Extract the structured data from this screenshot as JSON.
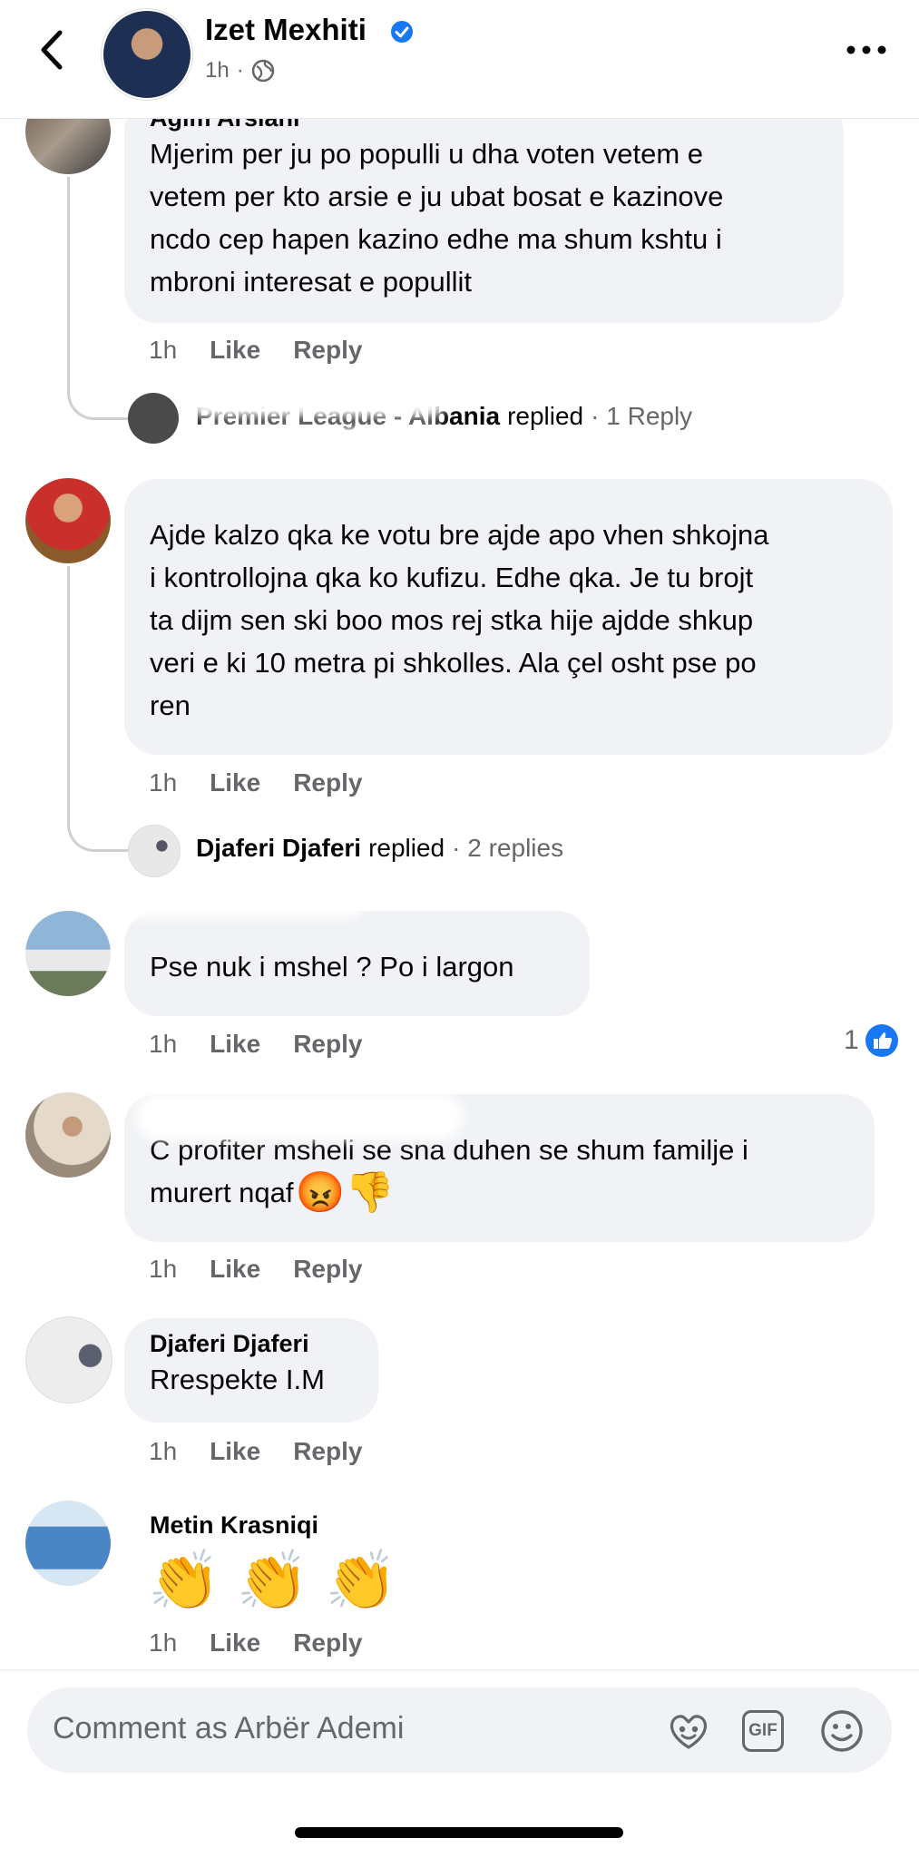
{
  "header": {
    "name": "Izet Mexhiti",
    "time": "1h",
    "separator": "·"
  },
  "comments": [
    {
      "name": "Agim Arslani",
      "lines": [
        "Mjerim per ju po populli u dha voten vetem e",
        "vetem per kto arsie e ju ubat bosat e kazinove",
        "ncdo cep hapen kazino edhe ma shum kshtu i",
        "mbroni interesat e popullit"
      ],
      "time": "1h",
      "like": "Like",
      "reply": "Reply"
    },
    {
      "name": "",
      "lines": [
        "Ajde kalzo qka ke votu bre ajde apo vhen shkojna",
        "i kontrollojna qka ko kufizu. Edhe qka. Je tu brojt",
        "ta dijm sen ski boo mos rej stka hije  ajdde shkup",
        "veri e ki 10 metra pi shkolles. Ala çel osht  pse po",
        "ren"
      ],
      "time": "1h",
      "like": "Like",
      "reply": "Reply"
    },
    {
      "name": "",
      "lines": [
        "Pse nuk i mshel ? Po i largon"
      ],
      "time": "1h",
      "like": "Like",
      "reply": "Reply",
      "reaction_count": "1"
    },
    {
      "name": "",
      "lines": [
        "C profiter msheli se sna duhen se shum familje i",
        "murert nqaf"
      ],
      "emojis": "😡👎",
      "time": "1h",
      "like": "Like",
      "reply": "Reply"
    },
    {
      "name": "Djaferi Djaferi",
      "lines": [
        "Rrespekte I.M"
      ],
      "time": "1h",
      "like": "Like",
      "reply": "Reply"
    },
    {
      "name": "Metin Krasniqi",
      "emojis": "👏👏👏",
      "time": "1h",
      "like": "Like",
      "reply": "Reply"
    }
  ],
  "replies": [
    {
      "name": "Premier League - Albania",
      "action": "replied",
      "meta": "· 1 Reply"
    },
    {
      "name": "Djaferi Djaferi",
      "action": "replied",
      "meta": "· 2 replies"
    }
  ],
  "composer": {
    "placeholder": "Comment as Arbër Ademi",
    "gif_label": "GIF"
  },
  "colors": {
    "bubble": "#f0f2f5",
    "muted": "#65676b",
    "accent": "#1877f2",
    "verified": "#1877f2"
  },
  "icons": [
    "back-chevron-icon",
    "verified-badge-icon",
    "globe-icon",
    "more-icon",
    "like-reaction-icon",
    "avatar-sticker-icon",
    "gif-icon",
    "smiley-icon"
  ]
}
